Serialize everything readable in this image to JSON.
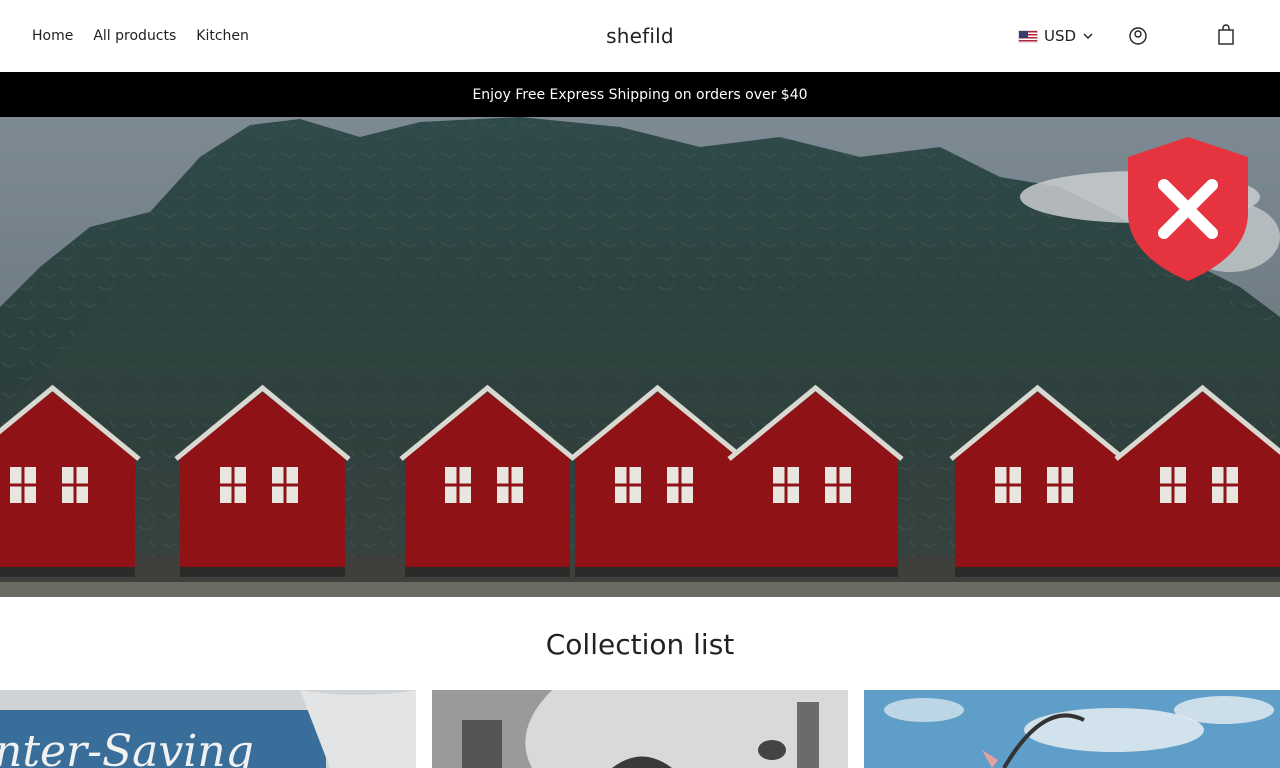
{
  "nav": {
    "items": [
      {
        "label": "Home"
      },
      {
        "label": "All products"
      },
      {
        "label": "Kitchen"
      }
    ]
  },
  "store": {
    "name": "shefild"
  },
  "currency": {
    "code": "USD",
    "flag_icon": "us-flag-icon"
  },
  "icons": {
    "account": "account-icon",
    "cart": "cart-icon",
    "blocked": "shield-x-icon"
  },
  "announcement": {
    "text": "Enjoy Free Express Shipping on orders over $40"
  },
  "collection": {
    "title": "Collection list",
    "cards": [
      {
        "image_text": "nter-Saving"
      },
      {
        "image_text": ""
      },
      {
        "image_text": ""
      }
    ]
  },
  "colors": {
    "announce_bg": "#000000",
    "shield_red": "#e5343f",
    "barn_red": "#8f1216"
  }
}
